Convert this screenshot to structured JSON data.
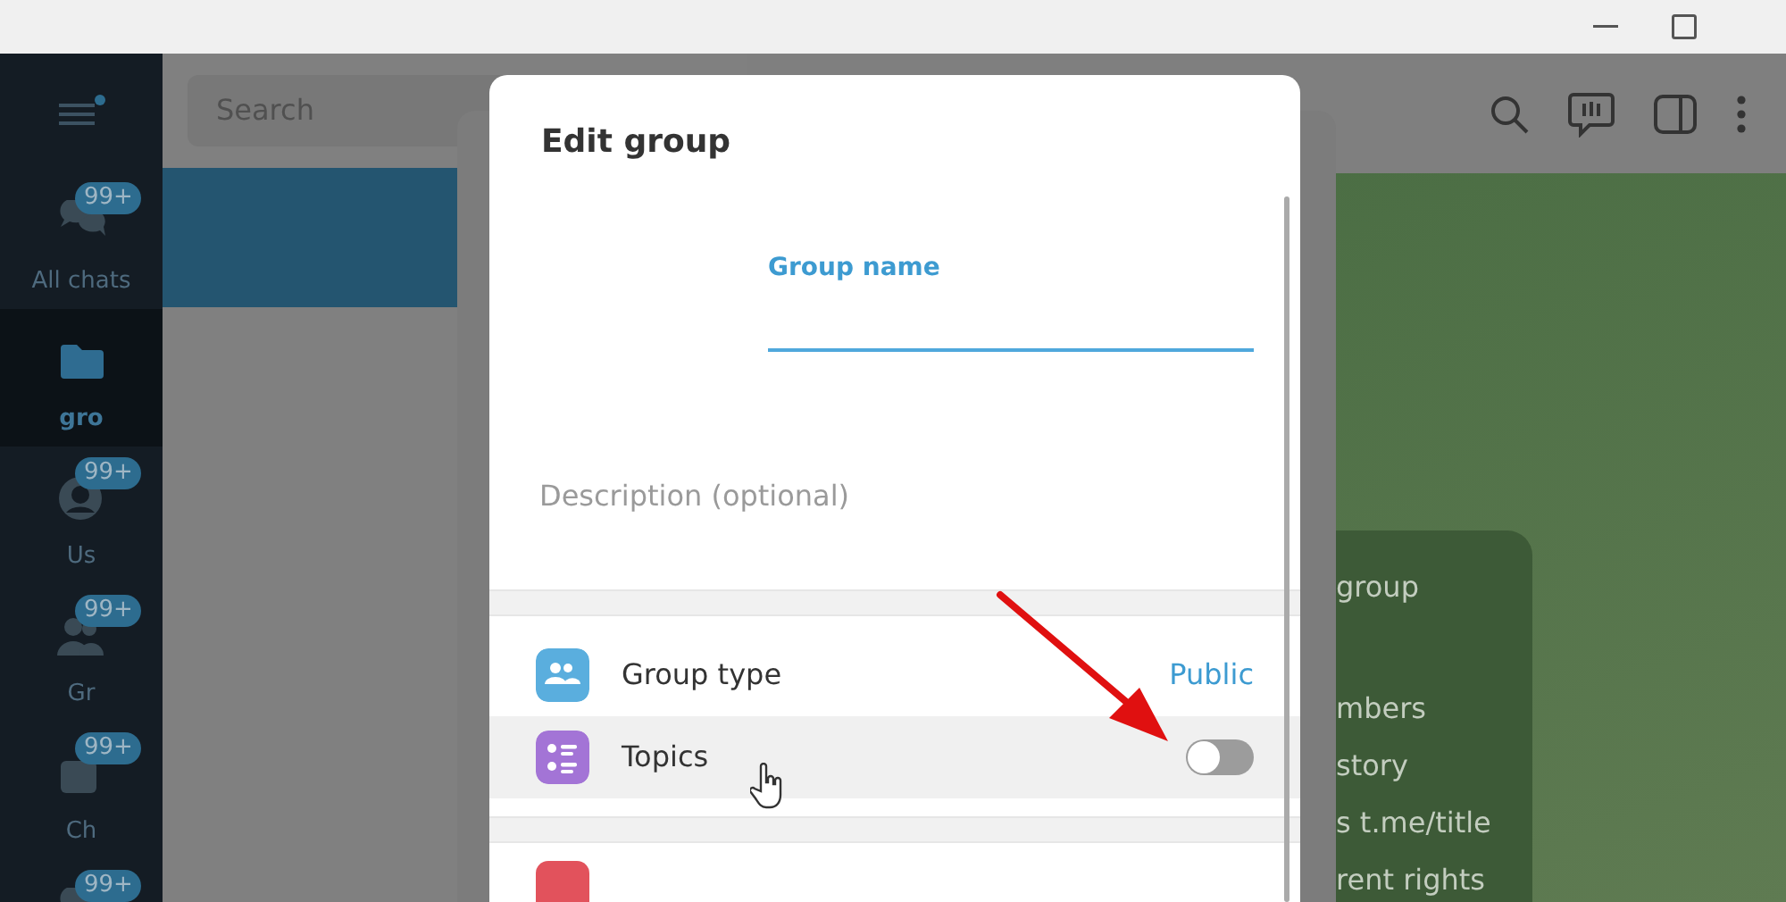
{
  "sidebar": {
    "folders": [
      {
        "kind": "chats",
        "label": "All chats",
        "badge": "99+",
        "selected": false
      },
      {
        "kind": "folder",
        "label": "gro",
        "selected": true
      },
      {
        "kind": "user",
        "label": "Us",
        "badge": "99+",
        "selected": false
      },
      {
        "kind": "group",
        "label": "Gr",
        "badge": "99+",
        "selected": false
      },
      {
        "kind": "channel",
        "label": "Ch",
        "badge": "99+",
        "selected": false
      },
      {
        "kind": "chats",
        "badge": "99+",
        "selected": false
      }
    ]
  },
  "search": {
    "placeholder": "Search"
  },
  "chat_list": {
    "rows": [
      {
        "selected": true
      },
      {
        "selected": false
      }
    ]
  },
  "info_card": {
    "lines": [
      "group",
      "mbers",
      "story",
      "s t.me/title",
      "rent rights"
    ]
  },
  "dialog": {
    "title": "Edit group",
    "group_name": {
      "label": "Group name",
      "focused": true
    },
    "description": {
      "placeholder": "Description (optional)"
    },
    "settings": [
      {
        "kind": "link",
        "color": "#5aaede",
        "label": "Group type",
        "value": "Public",
        "hovered": false
      },
      {
        "kind": "toggle",
        "color": "#a374d6",
        "label": "Topics",
        "on": false,
        "hovered": true
      }
    ],
    "next_section": [
      {
        "color": "#e2525c"
      }
    ]
  }
}
